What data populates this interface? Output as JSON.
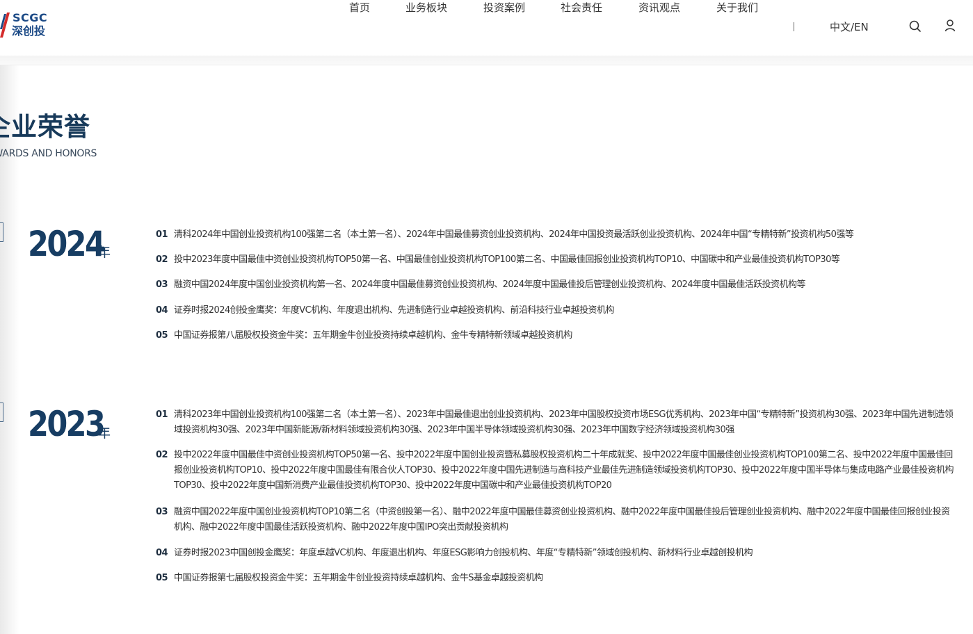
{
  "brand": {
    "logo_en": "SCGC",
    "logo_cn": "深创投",
    "colors": {
      "primary": "#173d63",
      "logo_blue": "#1c4a86",
      "logo_red": "#d42b2b"
    }
  },
  "nav": {
    "items": [
      "首页",
      "业务板块",
      "投资案例",
      "社会责任",
      "资讯观点",
      "关于我们"
    ],
    "separator": "|",
    "language": "中文/EN",
    "search_icon": "search-icon",
    "user_icon": "user-icon"
  },
  "page": {
    "title_cn": "企业荣誉",
    "title_en": "AWARDS AND HONORS"
  },
  "years": [
    {
      "year": "2024",
      "suffix": "年",
      "items": [
        {
          "num": "01",
          "text": "清科2024年中国创业投资机构100强第二名（本土第一名）、2024年中国最佳募资创业投资机构、2024年中国投资最活跃创业投资机构、2024年中国“专精特新”投资机构50强等"
        },
        {
          "num": "02",
          "text": "投中2023年度中国最佳中资创业投资机构TOP50第一名、中国最佳创业投资机构TOP100第二名、中国最佳回报创业投资机构TOP10、中国碳中和产业最佳投资机构TOP30等"
        },
        {
          "num": "03",
          "text": "融资中国2024年度中国创业投资机构第一名、2024年度中国最佳募资创业投资机构、2024年度中国最佳投后管理创业投资机构、2024年度中国最佳活跃投资机构等"
        },
        {
          "num": "04",
          "text": "证券时报2024创投金鹰奖：年度VC机构、年度退出机构、先进制造行业卓越投资机构、前沿科技行业卓越投资机构"
        },
        {
          "num": "05",
          "text": "中国证券报第八届股权投资金牛奖：五年期金牛创业投资持续卓越机构、金牛专精特新领域卓越投资机构"
        }
      ]
    },
    {
      "year": "2023",
      "suffix": "年",
      "items": [
        {
          "num": "01",
          "text": "清科2023年中国创业投资机构100强第二名（本土第一名）、2023年中国最佳退出创业投资机构、2023年中国股权投资市场ESG优秀机构、2023年中国“专精特新”投资机构30强、2023年中国先进制造领域投资机构30强、2023年中国新能源/新材料领域投资机构30强、2023年中国半导体领域投资机构30强、2023年中国数字经济领域投资机构30强"
        },
        {
          "num": "02",
          "text": "投中2022年度中国最佳中资创业投资机构TOP50第一名、投中2022年度中国创业投资暨私募股权投资机构二十年成就奖、投中2022年度中国最佳创业投资机构TOP100第二名、投中2022年度中国最佳回报创业投资机构TOP10、投中2022年度中国最佳有限合伙人TOP30、投中2022年度中国先进制造与高科技产业最佳先进制造领域投资机构TOP30、投中2022年度中国半导体与集成电路产业最佳投资机构TOP30、投中2022年度中国新消费产业最佳投资机构TOP30、投中2022年度中国碳中和产业最佳投资机构TOP20"
        },
        {
          "num": "03",
          "text": "融资中国2022年度中国创业投资机构TOP10第二名（中资创投第一名）、融中2022年度中国最佳募资创业投资机构、融中2022年度中国最佳投后管理创业投资机构、融中2022年度中国最佳回报创业投资机构、融中2022年度中国最佳活跃投资机构、融中2022年度中国IPO突出贡献投资机构"
        },
        {
          "num": "04",
          "text": "证券时报2023中国创投金鹰奖：年度卓越VC机构、年度退出机构、年度ESG影响力创投机构、年度“专精特新”领域创投机构、新材料行业卓越创投机构"
        },
        {
          "num": "05",
          "text": "中国证券报第七届股权投资金牛奖：五年期金牛创业投资持续卓越机构、金牛S基金卓越投资机构"
        }
      ]
    }
  ]
}
